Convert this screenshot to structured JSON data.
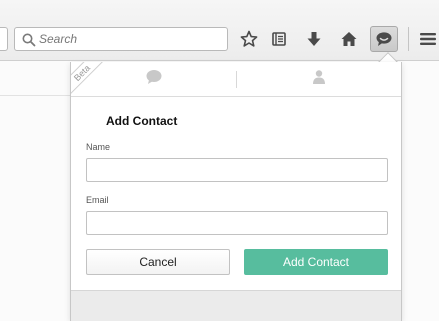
{
  "toolbar": {
    "search": {
      "placeholder": "Search",
      "value": ""
    },
    "buttons": [
      {
        "name": "bookmark-star",
        "icon": "star-icon"
      },
      {
        "name": "reading-list",
        "icon": "reading-list-icon"
      },
      {
        "name": "downloads",
        "icon": "download-arrow-icon"
      },
      {
        "name": "home",
        "icon": "home-icon"
      },
      {
        "name": "hello",
        "icon": "chat-bubble-icon",
        "active": true
      },
      {
        "name": "menu",
        "icon": "hamburger-menu-icon"
      }
    ]
  },
  "panel": {
    "beta_label": "Beta",
    "tabs": [
      {
        "name": "conversations",
        "icon": "chat-bubble-icon"
      },
      {
        "name": "contacts",
        "icon": "person-icon"
      }
    ],
    "form": {
      "title": "Add Contact",
      "name_label": "Name",
      "name_value": "",
      "email_label": "Email",
      "email_value": "",
      "cancel_label": "Cancel",
      "add_label": "Add Contact"
    },
    "footer": {
      "text": ""
    }
  },
  "colors": {
    "accent": "#57bd9e",
    "toolbar_bg": "#ececec",
    "icon": "#4a4a4a",
    "tab_icon": "#c8c8c8"
  }
}
